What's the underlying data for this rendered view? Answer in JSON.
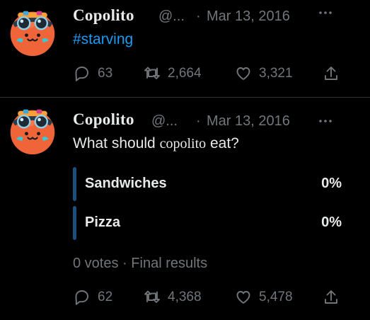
{
  "tweets": [
    {
      "name": "Copolito",
      "handle": "@...",
      "separator": "·",
      "date": "Mar 13, 2016",
      "text": "#starving",
      "replies": "63",
      "retweets": "2,664",
      "likes": "3,321"
    },
    {
      "name": "Copolito",
      "handle": "@...",
      "separator": "·",
      "date": "Mar 13, 2016",
      "text_before": "What should ",
      "text_name": "copolito",
      "text_after": " eat?",
      "poll": {
        "options": [
          {
            "label": "Sandwiches",
            "percent": "0%"
          },
          {
            "label": "Pizza",
            "percent": "0%"
          }
        ],
        "votes": "0 votes",
        "separator": "·",
        "status": "Final results"
      },
      "replies": "62",
      "retweets": "4,368",
      "likes": "5,478"
    }
  ],
  "colors": {
    "background": "#000000",
    "text": "#e7e9ea",
    "muted": "#71767b",
    "link": "#1d9bf0",
    "poll_bar": "#1d4f7a",
    "divider": "#2f3336"
  },
  "icons": {
    "avatar": "orange-blob-with-goggles-avatar",
    "more": "more-horizontal-icon",
    "reply": "reply-icon",
    "retweet": "retweet-icon",
    "like": "heart-icon",
    "share": "share-icon"
  }
}
